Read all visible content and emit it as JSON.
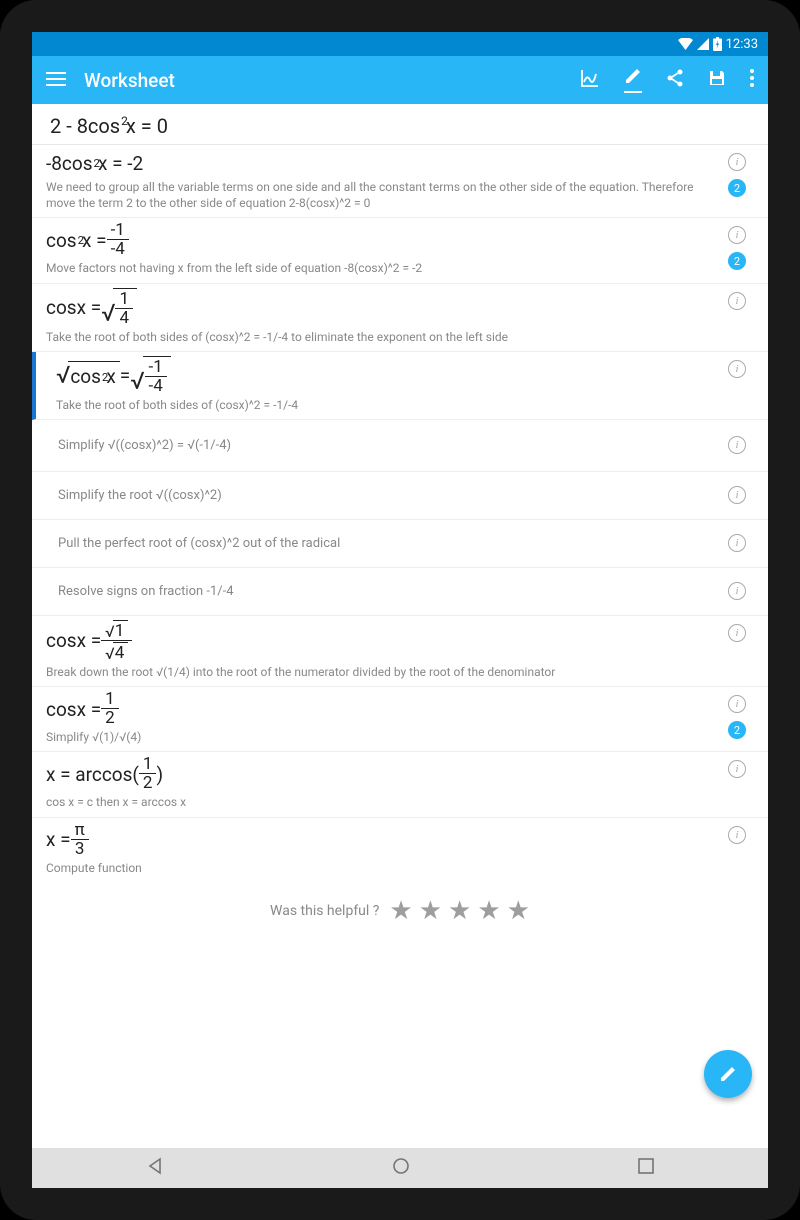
{
  "status": {
    "time": "12:33"
  },
  "appbar": {
    "title": "Worksheet"
  },
  "problem": {
    "eq_lhs": "2 - 8cos",
    "eq_exp": "2",
    "eq_rhs": "x = 0"
  },
  "steps": {
    "s1": {
      "eq_a": "-8cos",
      "eq_exp": "2",
      "eq_b": "x = -2",
      "expl": "We need to group all the variable terms on one side and all the constant terms on the other side of the equation. Therefore move the term 2 to the other side of equation 2-8(cosx)^2 = 0",
      "badge": "2"
    },
    "s2": {
      "eq_a": "cos",
      "eq_exp": "2",
      "eq_b": "x = ",
      "num": "-1",
      "den": "-4",
      "expl": "Move factors not having x from the left side of equation -8(cosx)^2 = -2",
      "badge": "2"
    },
    "s3": {
      "eq_a": "cosx = ",
      "num": "1",
      "den": "4",
      "expl": "Take the root of both sides of (cosx)^2 = -1/-4 to eliminate the exponent on the left side"
    },
    "s4": {
      "lhs_a": "cos",
      "lhs_exp": "2",
      "lhs_b": "x",
      "eq": " = ",
      "num": "-1",
      "den": "-4",
      "expl": "Take the root of both sides of (cosx)^2 = -1/-4"
    },
    "s5": {
      "expl": "Simplify √((cosx)^2) = √(-1/-4)"
    },
    "s6": {
      "expl": "Simplify the root √((cosx)^2)"
    },
    "s7": {
      "expl": "Pull the perfect root of (cosx)^2 out of the radical"
    },
    "s8": {
      "expl": "Resolve signs on fraction -1/-4"
    },
    "s9": {
      "eq_a": "cosx = ",
      "n_num": "1",
      "d_num": "4",
      "expl": "Break down the root √(1/4) into the root of the numerator divided by the root of the denominator"
    },
    "s10": {
      "eq_a": "cosx = ",
      "num": "1",
      "den": "2",
      "expl": "Simplify √(1)/√(4)",
      "badge": "2"
    },
    "s11": {
      "eq_a": "x = arccos(",
      "num": "1",
      "den": "2",
      "eq_b": ")",
      "expl": "cos x = c   then   x = arccos x"
    },
    "s12": {
      "eq_a": "x = ",
      "num": "π",
      "den": "3",
      "expl": "Compute function"
    }
  },
  "rating": {
    "label": "Was this helpful ?"
  },
  "info_char": "i"
}
